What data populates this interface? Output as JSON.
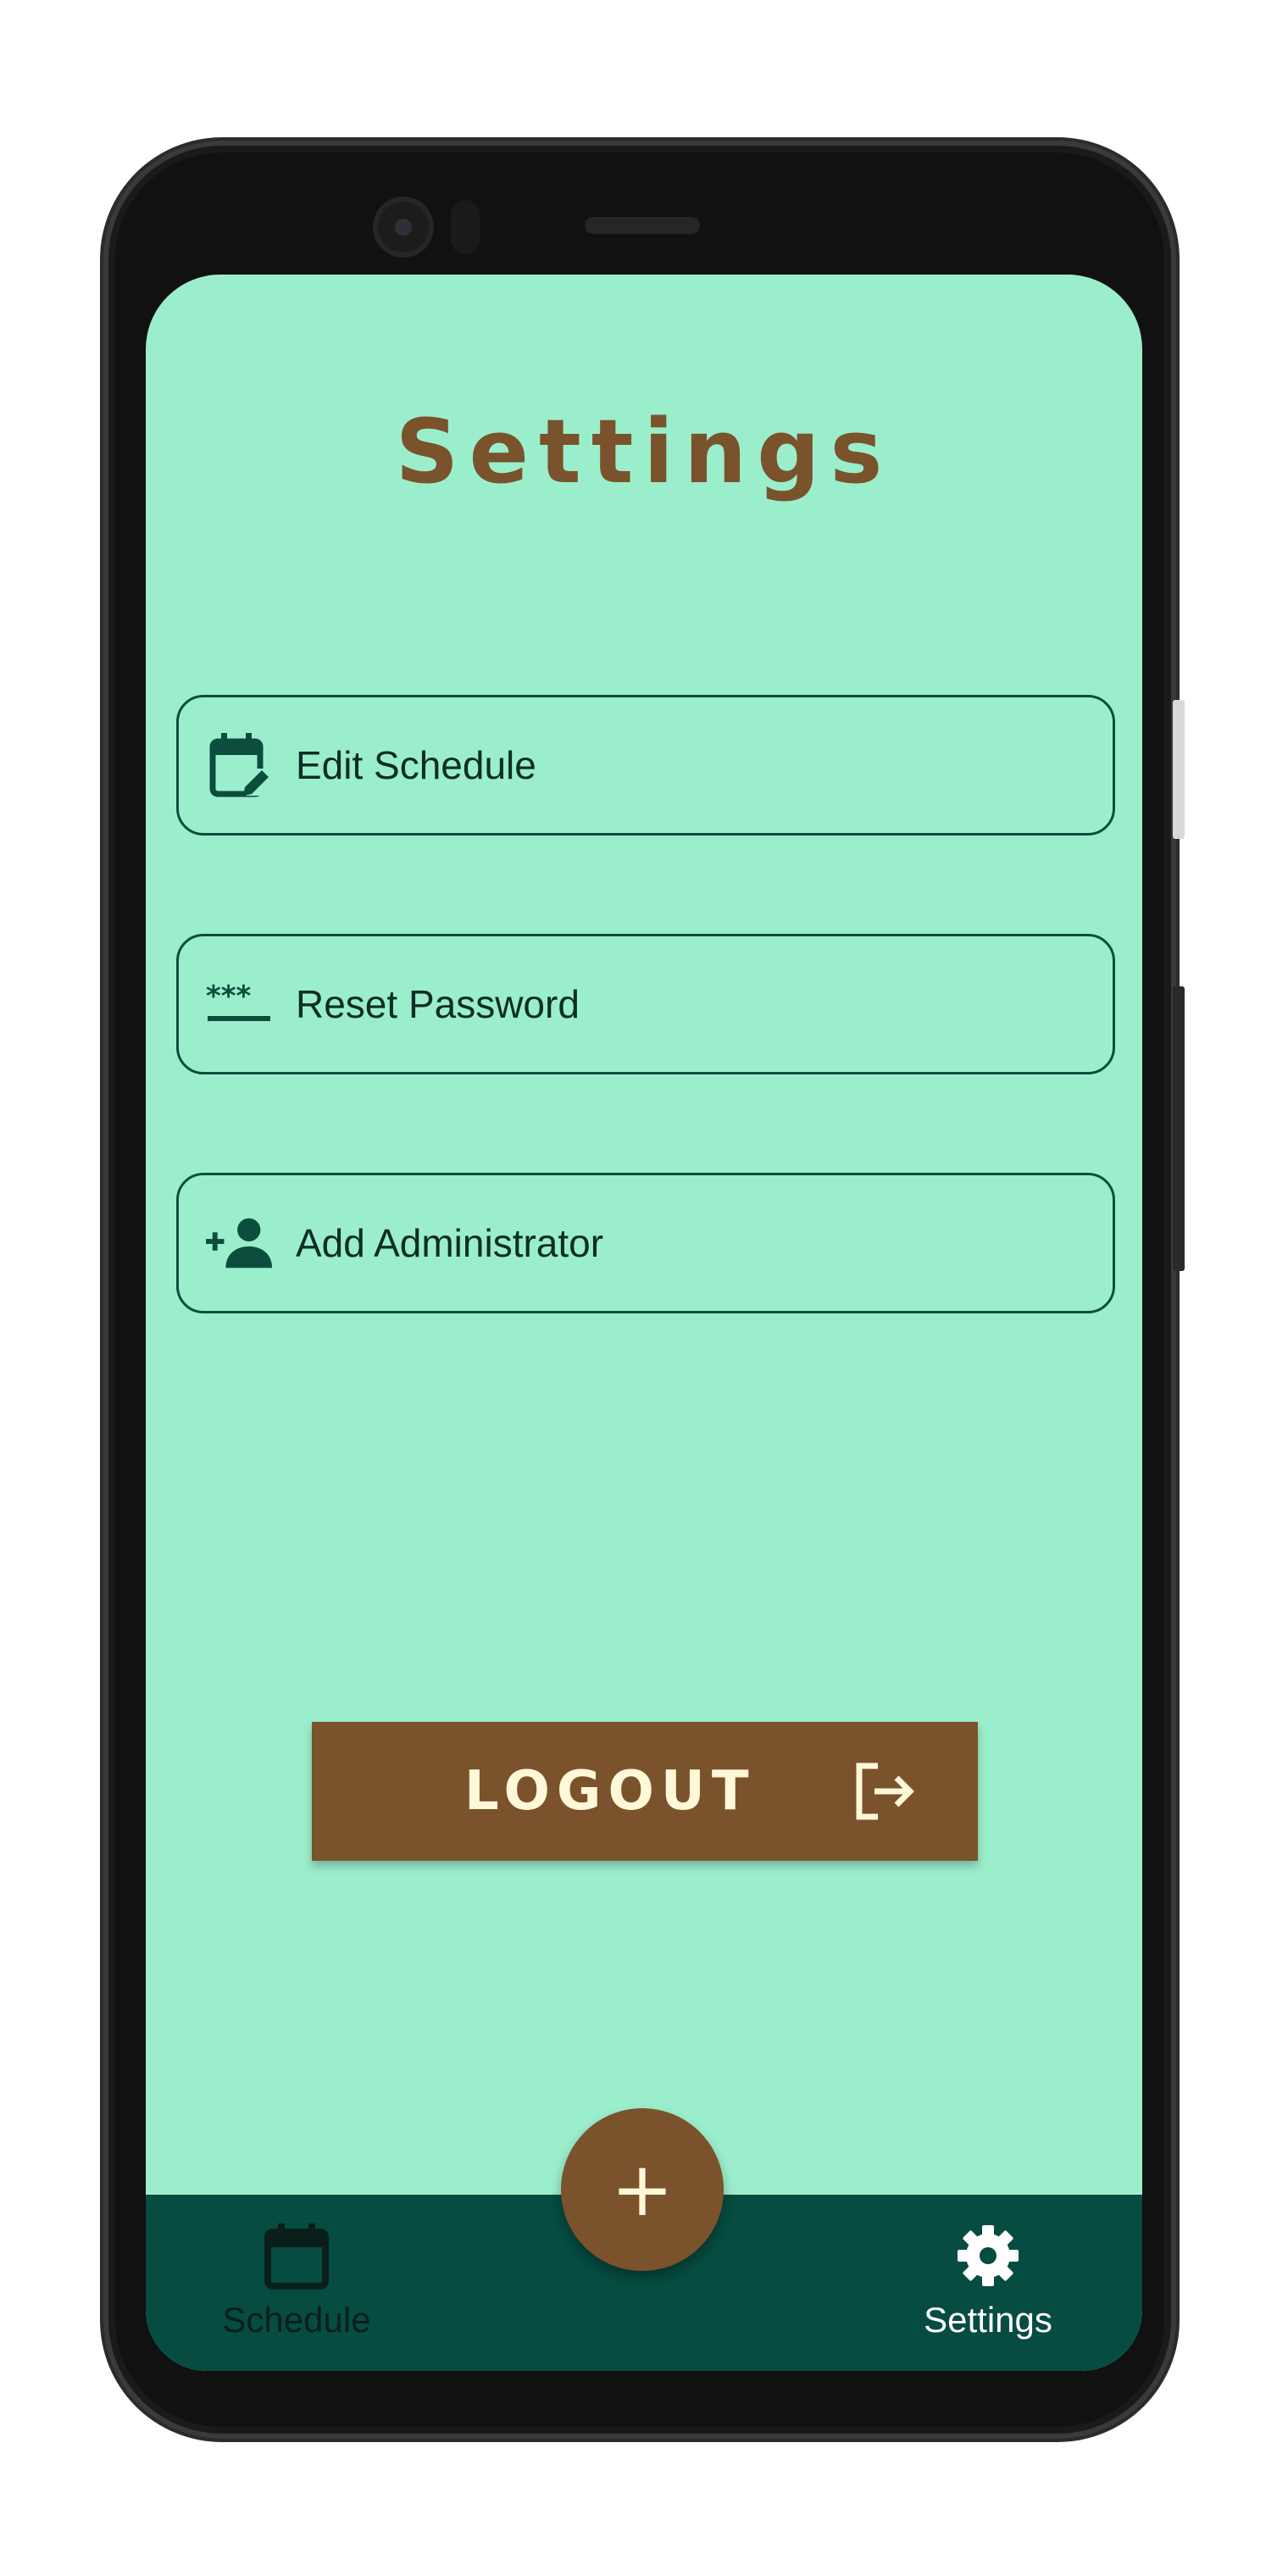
{
  "page": {
    "title": "Settings"
  },
  "menu": {
    "items": [
      {
        "label": "Edit Schedule",
        "icon": "calendar-edit-icon"
      },
      {
        "label": "Reset Password",
        "icon": "password-icon"
      },
      {
        "label": "Add Administrator",
        "icon": "person-add-icon"
      }
    ]
  },
  "logout": {
    "label": "LOGOUT",
    "icon": "logout-icon"
  },
  "fab": {
    "label": "+",
    "icon": "plus-icon"
  },
  "nav": {
    "items": [
      {
        "label": "Schedule",
        "icon": "calendar-icon",
        "active": false
      },
      {
        "label": "Settings",
        "icon": "gear-icon",
        "active": true
      }
    ]
  },
  "colors": {
    "background": "#9beecc",
    "accent": "#7a522b",
    "primary_dark": "#064c40",
    "outline": "#0c4d3d",
    "button_text": "#fff8d8"
  }
}
